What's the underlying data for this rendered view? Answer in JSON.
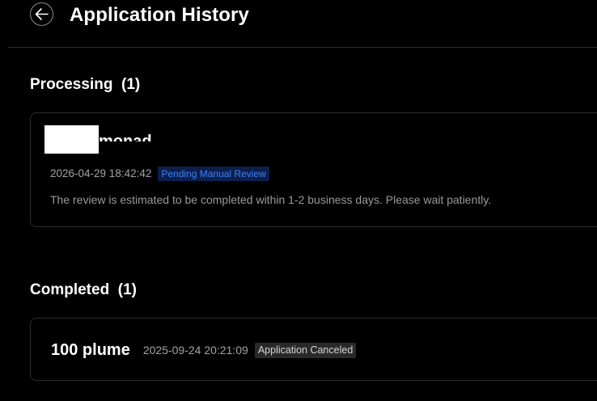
{
  "header": {
    "back_icon": "arrow-left-icon",
    "title": "Application History"
  },
  "processing": {
    "title": "Processing",
    "count": "(1)",
    "card": {
      "asset_name_visible": "monad",
      "asset_name_redacted": true,
      "timestamp": "2026-04-29 18:42:42",
      "status": "Pending Manual Review",
      "note": "The review is estimated to be completed within 1-2 business days. Please wait patiently."
    }
  },
  "completed": {
    "title": "Completed",
    "count": "(1)",
    "card": {
      "amount": "100 plume",
      "timestamp": "2025-09-24 20:21:09",
      "status": "Application Canceled"
    }
  },
  "colors": {
    "background": "#000000",
    "pending_badge_bg": "#0d1f4d",
    "pending_badge_text": "#3b82f6",
    "canceled_badge_bg": "#2a2a2a"
  }
}
